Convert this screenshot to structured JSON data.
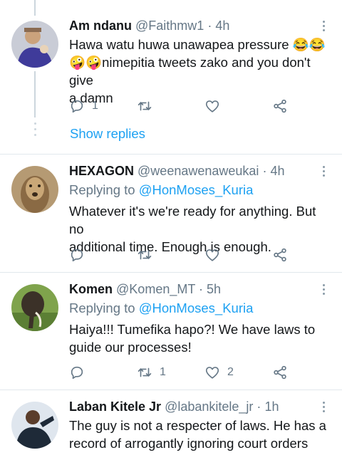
{
  "tweets": [
    {
      "name": "Am ndanu",
      "handle": "@Faithmw1",
      "time": "4h",
      "text_line1": "Hawa watu huwa unawapea pressure 😂😂",
      "text_line2": "🤪🤪nimepitia tweets zako and you don't give",
      "text_line3": "a damn",
      "reply_count": "1",
      "retweet_count": "",
      "like_count": "",
      "show_replies": "Show replies"
    },
    {
      "name": "HEXAGON",
      "handle": "@weenawenaweukai",
      "time": "4h",
      "replying_prefix": "Replying to",
      "replying_user": "@HonMoses_Kuria",
      "text_line1": "Whatever it's we're ready for anything. But no",
      "text_line2": "additional time. Enough is enough.",
      "reply_count": "",
      "retweet_count": "",
      "like_count": ""
    },
    {
      "name": "Komen",
      "handle": "@Komen_MT",
      "time": "5h",
      "replying_prefix": "Replying to",
      "replying_user": "@HonMoses_Kuria",
      "text_line1": "Haiya!!! Tumefika hapo?! We have laws to",
      "text_line2": "guide our processes!",
      "reply_count": "",
      "retweet_count": "1",
      "like_count": "2"
    },
    {
      "name": "Laban Kitele Jr",
      "handle": "@labankitele_jr",
      "time": "1h",
      "text_line1": "The guy is not a respecter of laws. He has a",
      "text_line2": "record of arrogantly ignoring court orders"
    }
  ],
  "separator_dot": "·",
  "colors": {
    "accent": "#1da1f2",
    "muted": "#657786",
    "text": "#14171a",
    "divider": "#e1e8ed"
  },
  "icons": [
    "reply-icon",
    "retweet-icon",
    "like-icon",
    "share-icon",
    "more-icon"
  ]
}
